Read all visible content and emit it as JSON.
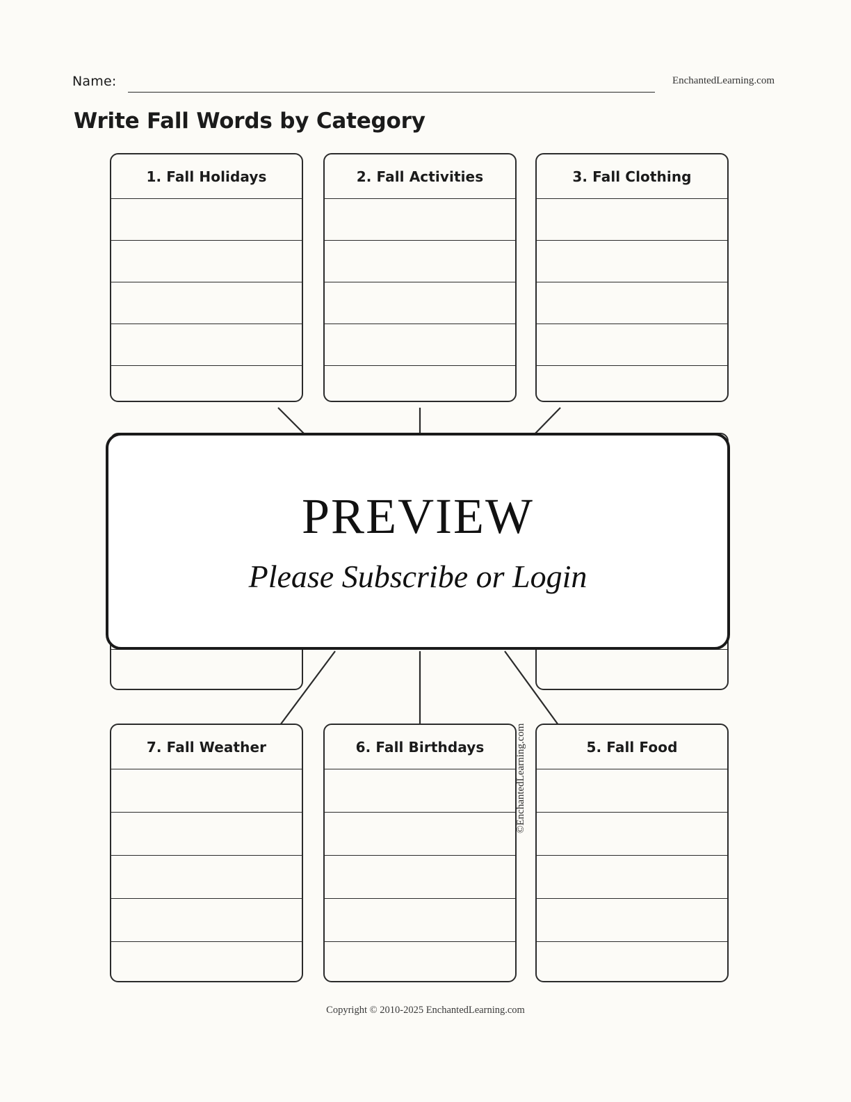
{
  "header": {
    "name_label": "Name:",
    "brand": "EnchantedLearning.com",
    "title": "Write Fall Words by Category"
  },
  "categories": [
    {
      "id": "fall-holidays",
      "label": "1. Fall Holidays",
      "lines": 5
    },
    {
      "id": "fall-activities",
      "label": "2. Fall Activities",
      "lines": 5
    },
    {
      "id": "fall-clothing",
      "label": "3. Fall Clothing",
      "lines": 5
    },
    {
      "id": "fall-weather",
      "label": "7. Fall Weather",
      "lines": 5
    },
    {
      "id": "fall-birthdays",
      "label": "6. Fall Birthdays",
      "lines": 5
    },
    {
      "id": "fall-food",
      "label": "5. Fall Food",
      "lines": 5
    }
  ],
  "middle_boxes": [
    {
      "id": "middle-left",
      "lines": 5
    },
    {
      "id": "middle-right",
      "lines": 5
    }
  ],
  "preview": {
    "title": "PREVIEW",
    "subtitle": "Please Subscribe or Login"
  },
  "watermark": {
    "side": "©EnchantedLearning.com"
  },
  "footer": {
    "copyright": "Copyright © 2010-2025 EnchantedLearning.com"
  },
  "colors": {
    "page_background": "#fcfbf7",
    "ink": "#2b2b2b",
    "preview_background": "#ffffff"
  }
}
